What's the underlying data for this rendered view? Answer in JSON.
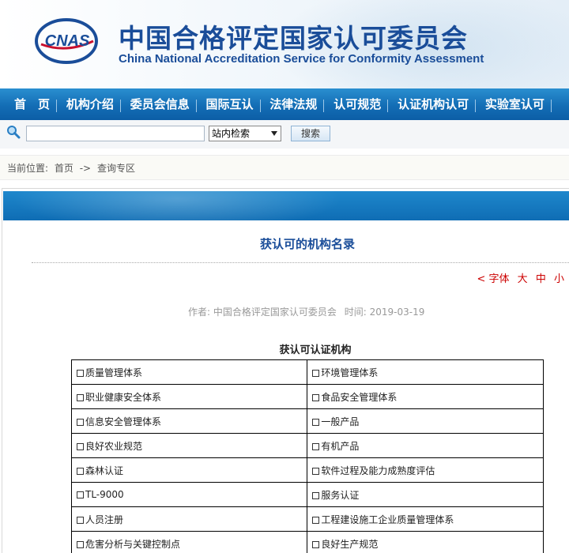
{
  "header": {
    "logo_text": "CNAS",
    "title_cn": "中国合格评定国家认可委员会",
    "title_en": "China National Accreditation Service for Conformity Assessment"
  },
  "nav": {
    "items": [
      "首　页",
      "机构介绍",
      "委员会信息",
      "国际互认",
      "法律法规",
      "认可规范",
      "认证机构认可",
      "实验室认可"
    ]
  },
  "search": {
    "input_value": "",
    "placeholder": "",
    "select_value": "站内检索",
    "button_label": "搜索"
  },
  "breadcrumb": {
    "label": "当前位置:",
    "home": "首页",
    "arrow": "->",
    "current": "查询专区"
  },
  "article": {
    "title": "获认可的机构名录",
    "font_label": "< 字体",
    "font_large": "大",
    "font_medium": "中",
    "font_small": "小",
    "author_label": "作者:",
    "author": "中国合格评定国家认可委员会",
    "time_label": "时间:",
    "date": "2019-03-19",
    "section_title": "获认可认证机构"
  },
  "table": {
    "rows": [
      [
        "质量管理体系",
        "环境管理体系"
      ],
      [
        "职业健康安全体系",
        "食品安全管理体系"
      ],
      [
        "信息安全管理体系",
        "一般产品"
      ],
      [
        "良好农业规范",
        "有机产品"
      ],
      [
        "森林认证",
        "软件过程及能力成熟度评估"
      ],
      [
        "TL-9000",
        "服务认证"
      ],
      [
        "人员注册",
        "工程建设施工企业质量管理体系"
      ],
      [
        "危害分析与关键控制点",
        "良好生产规范"
      ]
    ]
  },
  "colors": {
    "brand_blue": "#1a4d99",
    "nav_blue": "#136db5",
    "font_ctrl_red": "#cc0000"
  }
}
